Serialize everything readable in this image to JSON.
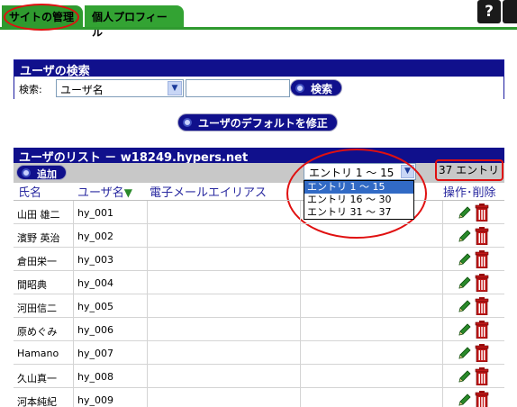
{
  "tabs": {
    "site_admin": "サイトの管理",
    "profile": "個人プロフィール",
    "help": "?"
  },
  "search": {
    "header": "ユーザの検索",
    "label": "検索:",
    "field_value": "ユーザ名",
    "text_value": "",
    "button": "検索"
  },
  "defaults_button": "ユーザのデフォルトを修正",
  "list": {
    "header": "ユーザのリスト － w18249.hypers.net",
    "add_button": "追加",
    "entries_select": "エントリ 1 ～ 15",
    "entries_options": [
      "エントリ 1 ～ 15",
      "エントリ 16 ～ 30",
      "エントリ 31 ～ 37"
    ],
    "count": "37 エントリ",
    "columns": {
      "name": "氏名",
      "username": "ユーザ名",
      "email": "電子メールエイリアス",
      "actions": "操作･削除"
    },
    "rows": [
      {
        "name": "山田 雄二",
        "username": "hy_001"
      },
      {
        "name": "濱野 英治",
        "username": "hy_002"
      },
      {
        "name": "倉田栄一",
        "username": "hy_003"
      },
      {
        "name": "間昭典",
        "username": "hy_004"
      },
      {
        "name": "河田信二",
        "username": "hy_005"
      },
      {
        "name": "原めぐみ",
        "username": "hy_006"
      },
      {
        "name": "Hamano",
        "username": "hy_007"
      },
      {
        "name": "久山真一",
        "username": "hy_008"
      },
      {
        "name": "河本純紀",
        "username": "hy_009"
      }
    ]
  },
  "colors": {
    "tab_green": "#33a333",
    "header_navy": "#10108c",
    "annotation_red": "#e01010",
    "selected_option": "#316ac5"
  }
}
